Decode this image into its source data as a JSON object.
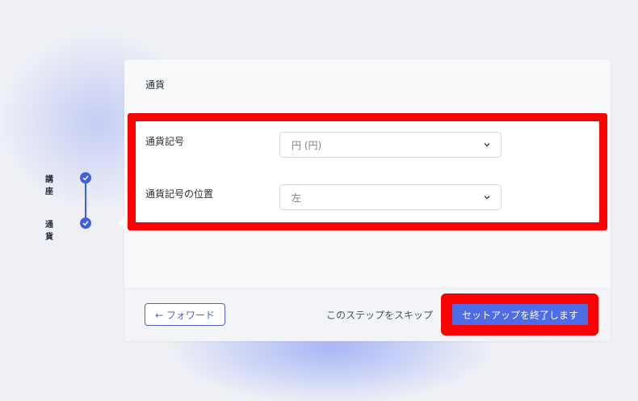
{
  "stepper": {
    "steps": [
      {
        "label": "講座",
        "status": "complete"
      },
      {
        "label": "通貨",
        "status": "current"
      }
    ],
    "accent_color": "#3f5fdc"
  },
  "card": {
    "title": "通貨",
    "fields": {
      "symbol": {
        "label": "通貨記号",
        "value": "円 (円)"
      },
      "position": {
        "label": "通貨記号の位置",
        "value": "左"
      }
    }
  },
  "footer": {
    "back_label": "← フォワード",
    "skip_label": "このステップをスキップ",
    "finish_label": "セットアップを終了します"
  },
  "highlight_color": "#ff0000"
}
